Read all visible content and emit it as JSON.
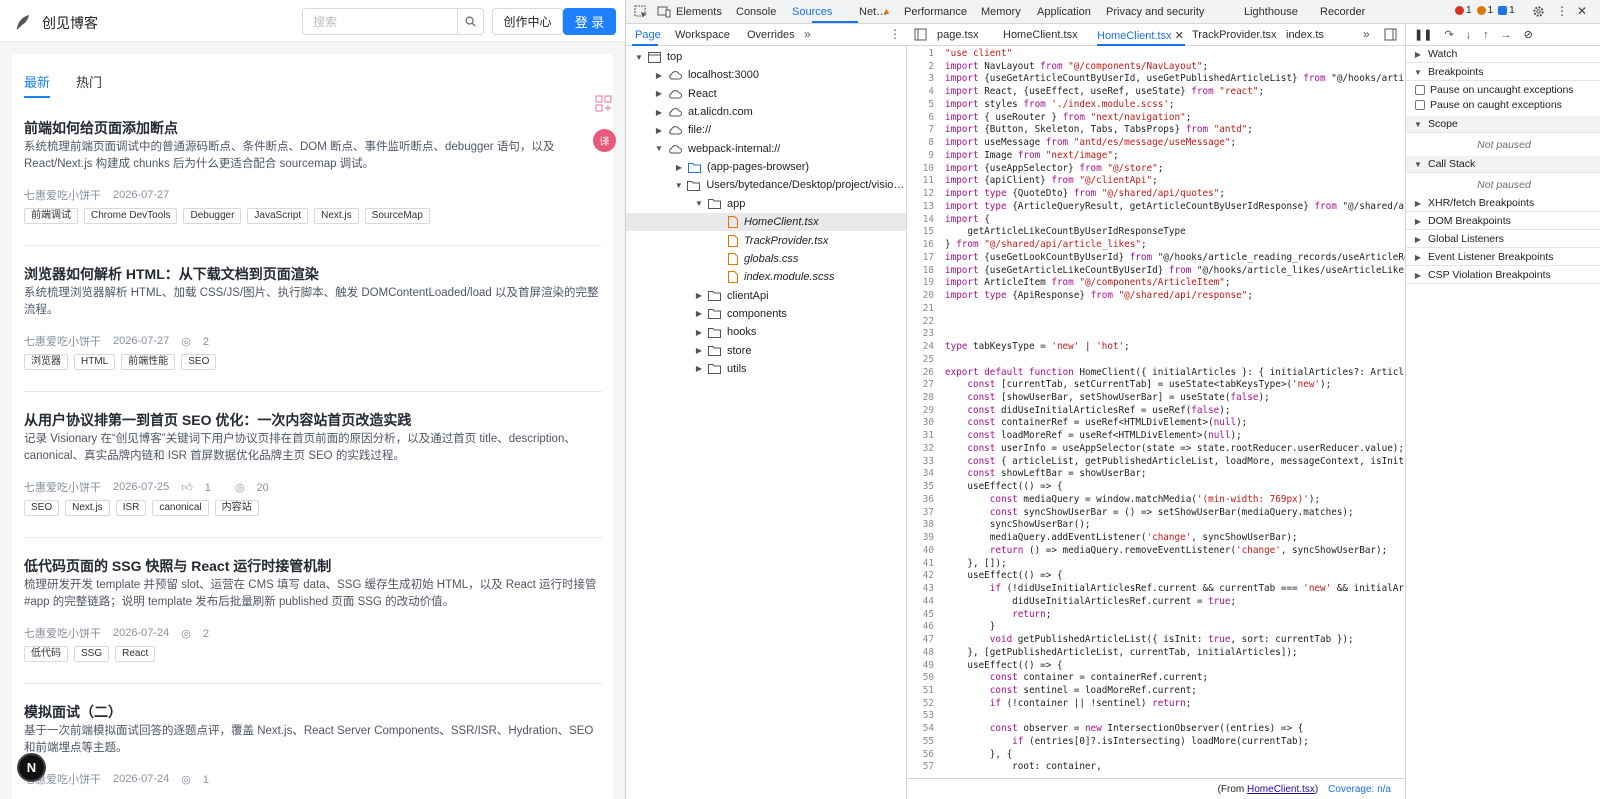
{
  "blog": {
    "brand": "创见博客",
    "search_placeholder": "搜索",
    "create_label": "创作中心",
    "login_label": "登 录",
    "tabs": [
      "最新",
      "热门"
    ],
    "float_badge": "译",
    "next_badge": "N",
    "articles": [
      {
        "title": "前端如何给页面添加断点",
        "desc": "系统梳理前端页面调试中的普通源码断点、条件断点、DOM 断点、事件监听断点、debugger 语句，以及 React/Next.js 构建成 chunks 后为什么更适合配合 sourcemap 调试。",
        "author": "七惠爱吃小饼干",
        "date": "2026-07-27",
        "likes": "",
        "views": "",
        "tags": [
          "前端调试",
          "Chrome DevTools",
          "Debugger",
          "JavaScript",
          "Next.js",
          "SourceMap"
        ]
      },
      {
        "title": "浏览器如何解析 HTML：从下载文档到页面渲染",
        "desc": "系统梳理浏览器解析 HTML、加载 CSS/JS/图片、执行脚本、触发 DOMContentLoaded/load 以及首屏渲染的完整流程。",
        "author": "七惠爱吃小饼干",
        "date": "2026-07-27",
        "likes": "",
        "views": "2",
        "tags": [
          "浏览器",
          "HTML",
          "前端性能",
          "SEO"
        ]
      },
      {
        "title": "从用户协议排第一到首页 SEO 优化：一次内容站首页改造实践",
        "desc": "记录 Visionary 在“创见博客”关键词下用户协议页排在首页前面的原因分析，以及通过首页 title、description、canonical、真实品牌内链和 ISR 首屏数据优化品牌主页 SEO 的实践过程。",
        "author": "七惠爱吃小饼干",
        "date": "2026-07-25",
        "likes": "1",
        "views": "20",
        "tags": [
          "SEO",
          "Next.js",
          "ISR",
          "canonical",
          "内容站"
        ]
      },
      {
        "title": "低代码页面的 SSG 快照与 React 运行时接管机制",
        "desc": "梳理研发开发 template 并预留 slot、运营在 CMS 填写 data、SSG 缓存生成初始 HTML，以及 React 运行时接管 #app 的完整链路；说明 template 发布后批量刷新 published 页面 SSG 的改动价值。",
        "author": "七惠爱吃小饼干",
        "date": "2026-07-24",
        "likes": "",
        "views": "2",
        "tags": [
          "低代码",
          "SSG",
          "React"
        ]
      },
      {
        "title": "模拟面试（二）",
        "desc": "基于一次前端模拟面试回答的逐题点评，覆盖 Next.js、React Server Components、SSR/ISR、Hydration、SEO 和前端埋点等主题。",
        "author": "七惠爱吃小饼干",
        "date": "2026-07-24",
        "likes": "",
        "views": "1",
        "tags": []
      }
    ]
  },
  "devtools": {
    "top_tabs": [
      "Elements",
      "Console",
      "Sources",
      "Net…",
      "Performance",
      "Memory",
      "Application",
      "Privacy and security",
      "Lighthouse",
      "Recorder"
    ],
    "active_top_tab": "Sources",
    "badges": {
      "errors": "1",
      "warnings": "1",
      "messages": "1"
    },
    "nav_tabs": [
      "Page",
      "Workspace",
      "Overrides"
    ],
    "tree": [
      {
        "label": "top",
        "indent": 0,
        "twisty": "▼",
        "icon": "frame-icon",
        "selected": false
      },
      {
        "label": "localhost:3000",
        "indent": 1,
        "twisty": "▶",
        "icon": "cloud-icon",
        "selected": false
      },
      {
        "label": "React",
        "indent": 1,
        "twisty": "▶",
        "icon": "cloud-icon",
        "selected": false
      },
      {
        "label": "at.alicdn.com",
        "indent": 1,
        "twisty": "▶",
        "icon": "cloud-icon",
        "selected": false
      },
      {
        "label": "file://",
        "indent": 1,
        "twisty": "▶",
        "icon": "cloud-icon",
        "selected": false
      },
      {
        "label": "webpack-internal://",
        "indent": 1,
        "twisty": "▼",
        "icon": "cloud-icon",
        "selected": false
      },
      {
        "label": "(app-pages-browser)",
        "indent": 2,
        "twisty": "▶",
        "icon": "folder-blue-icon",
        "selected": false
      },
      {
        "label": "Users/bytedance/Desktop/project/visionar…",
        "indent": 2,
        "twisty": "▼",
        "icon": "folder-icon",
        "selected": false
      },
      {
        "label": "app",
        "indent": 3,
        "twisty": "▼",
        "icon": "folder-icon",
        "selected": false
      },
      {
        "label": "HomeClient.tsx",
        "indent": 4,
        "twisty": "",
        "icon": "file-icon",
        "selected": true
      },
      {
        "label": "TrackProvider.tsx",
        "indent": 4,
        "twisty": "",
        "icon": "file-icon",
        "selected": false
      },
      {
        "label": "globals.css",
        "indent": 4,
        "twisty": "",
        "icon": "file-icon",
        "selected": false
      },
      {
        "label": "index.module.scss",
        "indent": 4,
        "twisty": "",
        "icon": "file-icon",
        "selected": false
      },
      {
        "label": "clientApi",
        "indent": 3,
        "twisty": "▶",
        "icon": "folder-icon",
        "selected": false
      },
      {
        "label": "components",
        "indent": 3,
        "twisty": "▶",
        "icon": "folder-icon",
        "selected": false
      },
      {
        "label": "hooks",
        "indent": 3,
        "twisty": "▶",
        "icon": "folder-icon",
        "selected": false
      },
      {
        "label": "store",
        "indent": 3,
        "twisty": "▶",
        "icon": "folder-icon",
        "selected": false
      },
      {
        "label": "utils",
        "indent": 3,
        "twisty": "▶",
        "icon": "folder-icon",
        "selected": false
      }
    ],
    "editor_tabs": [
      "page.tsx",
      "HomeClient.tsx",
      "HomeClient.tsx",
      "TrackProvider.tsx",
      "index.ts"
    ],
    "active_editor_tab": 2,
    "code_lines": [
      "\"use client\"",
      "import NavLayout from \"@/components/NavLayout\";",
      "import {useGetArticleCountByUserId, useGetPublishedArticleList} from \"@/hooks/arti",
      "import React, {useEffect, useRef, useState} from \"react\";",
      "import styles from './index.module.scss';",
      "import { useRouter } from \"next/navigation\";",
      "import {Button, Skeleton, Tabs, TabsProps} from \"antd\";",
      "import useMessage from \"antd/es/message/useMessage\";",
      "import Image from \"next/image\";",
      "import {useAppSelector} from \"@/store\";",
      "import {apiClient} from \"@/clientApi\";",
      "import type {QuoteDto} from \"@/shared/api/quotes\";",
      "import type {ArticleQueryResult, getArticleCountByUserIdResponse} from \"@/shared/a",
      "import {",
      "    getArticleLikeCountByUserIdResponseType",
      "} from \"@/shared/api/article_likes\";",
      "import {useGetLookCountByUserId} from \"@/hooks/article_reading_records/useArticleRe",
      "import {useGetArticleLikeCountByUserId} from \"@/hooks/article_likes/useArticleLike",
      "import ArticleItem from \"@/components/ArticleItem\";",
      "import type {ApiResponse} from \"@/shared/api/response\";",
      "",
      "",
      "",
      "type tabKeysType = 'new' | 'hot';",
      "",
      "export default function HomeClient({ initialArticles }: { initialArticles?: Articl",
      "    const [currentTab, setCurrentTab] = useState<tabKeysType>('new');",
      "    const [showUserBar, setShowUserBar] = useState(false);",
      "    const didUseInitialArticlesRef = useRef(false);",
      "    const containerRef = useRef<HTMLDivElement>(null);",
      "    const loadMoreRef = useRef<HTMLDivElement>(null);",
      "    const userInfo = useAppSelector(state => state.rootReducer.userReducer.value);",
      "    const { articleList, getPublishedArticleList, loadMore, messageContext, isInit",
      "    const showLeftBar = showUserBar;",
      "    useEffect(() => {",
      "        const mediaQuery = window.matchMedia('(min-width: 769px)');",
      "        const syncShowUserBar = () => setShowUserBar(mediaQuery.matches);",
      "        syncShowUserBar();",
      "        mediaQuery.addEventListener('change', syncShowUserBar);",
      "        return () => mediaQuery.removeEventListener('change', syncShowUserBar);",
      "    }, []);",
      "    useEffect(() => {",
      "        if (!didUseInitialArticlesRef.current && currentTab === 'new' && initialAr",
      "            didUseInitialArticlesRef.current = true;",
      "            return;",
      "        }",
      "        void getPublishedArticleList({ isInit: true, sort: currentTab });",
      "    }, [getPublishedArticleList, currentTab, initialArticles]);",
      "    useEffect(() => {",
      "        const container = containerRef.current;",
      "        const sentinel = loadMoreRef.current;",
      "        if (!container || !sentinel) return;",
      "",
      "        const observer = new IntersectionObserver((entries) => {",
      "            if (entries[0]?.isIntersecting) loadMore(currentTab);",
      "        }, {",
      "            root: container,"
    ],
    "status_from": "(From",
    "status_file": "HomeClient.tsx",
    "status_close": ")",
    "coverage": "Coverage: n/a",
    "debug": {
      "watch": "Watch",
      "breakpoints": "Breakpoints",
      "pause_uncaught": "Pause on uncaught exceptions",
      "pause_caught": "Pause on caught exceptions",
      "scope": "Scope",
      "not_paused": "Not paused",
      "call_stack": "Call Stack",
      "sections": [
        "XHR/fetch Breakpoints",
        "DOM Breakpoints",
        "Global Listeners",
        "Event Listener Breakpoints",
        "CSP Violation Breakpoints"
      ]
    }
  },
  "colors": {
    "accent_blog": "#1e80ff",
    "accent_devtools": "#1a73e8",
    "error": "#d93025",
    "warning": "#e37400",
    "info": "#1a73e8"
  }
}
